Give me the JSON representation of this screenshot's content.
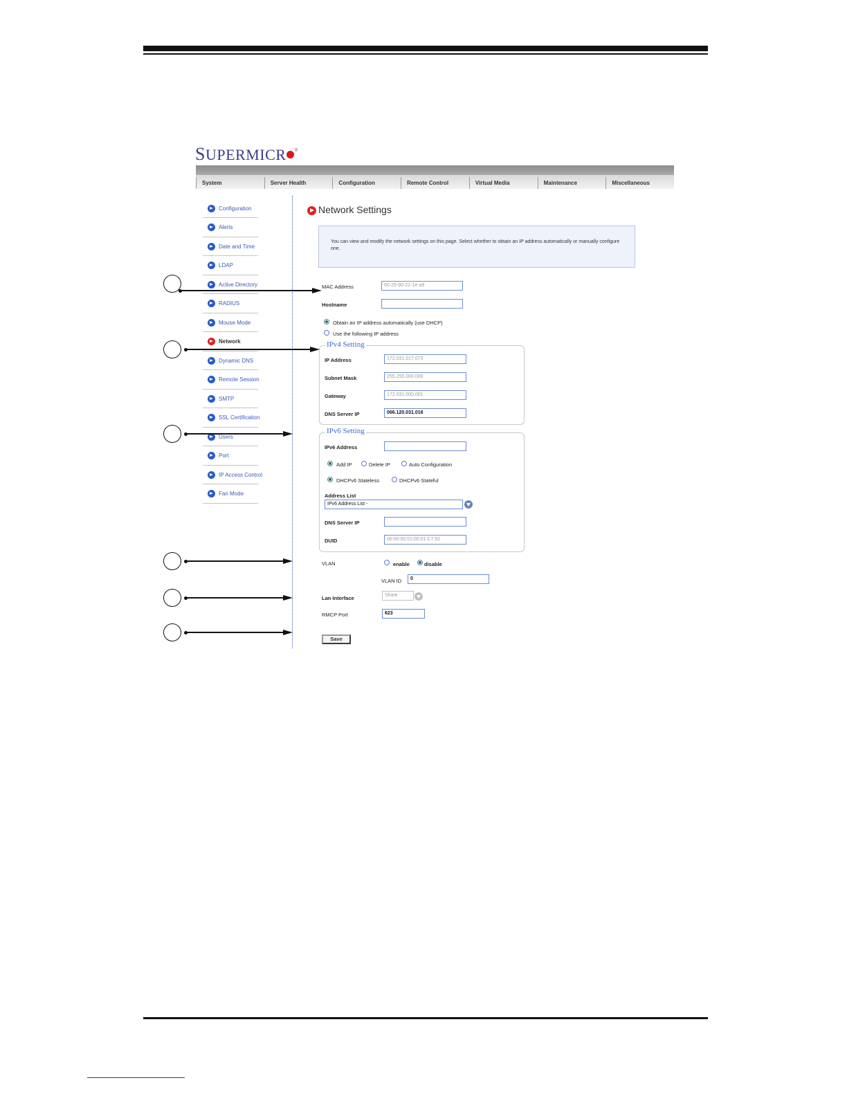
{
  "logo": {
    "text_first": "S",
    "text_rest": "UPERMICR",
    "reg": "®"
  },
  "nav": {
    "tabs": [
      "System",
      "Server Health",
      "Configuration",
      "Remote Control",
      "Virtual Media",
      "Maintenance",
      "Miscellaneous"
    ]
  },
  "sidebar": {
    "items": [
      {
        "label": "Configuration"
      },
      {
        "label": "Alerts"
      },
      {
        "label": "Date and Time"
      },
      {
        "label": "LDAP"
      },
      {
        "label": "Active Directory"
      },
      {
        "label": "RADIUS"
      },
      {
        "label": "Mouse Mode"
      },
      {
        "label": "Network",
        "active": true
      },
      {
        "label": "Dynamic DNS"
      },
      {
        "label": "Remote Session"
      },
      {
        "label": "SMTP"
      },
      {
        "label": "SSL Certification"
      },
      {
        "label": "Users"
      },
      {
        "label": "Port"
      },
      {
        "label": "IP Access Control"
      },
      {
        "label": "Fan Mode"
      }
    ]
  },
  "page": {
    "title": "Network Settings",
    "description": "You can view and modify the network settings on this page. Select whether to obtain an IP address automatically or manually configure one."
  },
  "general": {
    "mac_label": "MAC Address",
    "mac_value": "00-25-90-22-1e-a9",
    "hostname_label": "Hostname",
    "hostname_value": "",
    "radio_dhcp": "Obtain an IP address automatically (use DHCP)",
    "radio_static": "Use the following IP address"
  },
  "ipv4": {
    "legend": "IPv4 Setting",
    "ip_label": "IP Address",
    "ip_value": "172.031.017.073",
    "mask_label": "Subnet Mask",
    "mask_value": "255.255.000.000",
    "gw_label": "Gateway",
    "gw_value": "172.031.000.001",
    "dns_label": "DNS Server IP",
    "dns_value": "066.120.031.016"
  },
  "ipv6": {
    "legend": "IPv6 Setting",
    "addr_label": "IPv6 Address",
    "addr_value": "",
    "opt_add": "Add IP",
    "opt_delete": "Delete IP",
    "opt_auto": "Auto Configuration",
    "opt_stateless": "DHCPv6 Stateless",
    "opt_stateful": "DHCPv6 Stateful",
    "list_label": "Address List",
    "list_value": "IPv6 Address List -",
    "dns_label": "DNS Server IP",
    "dns_value": "",
    "duid_label": "DUID",
    "duid_value": "00:00:00:01:00:01:C7:92"
  },
  "vlan": {
    "label": "VLAN",
    "opt_enable": "enable",
    "opt_disable": "disable",
    "id_label": "VLAN ID",
    "id_value": "0"
  },
  "lan": {
    "label": "Lan Interface",
    "value": "Share"
  },
  "rmcp": {
    "label": "RMCP Port",
    "value": "623"
  },
  "save_label": "Save"
}
